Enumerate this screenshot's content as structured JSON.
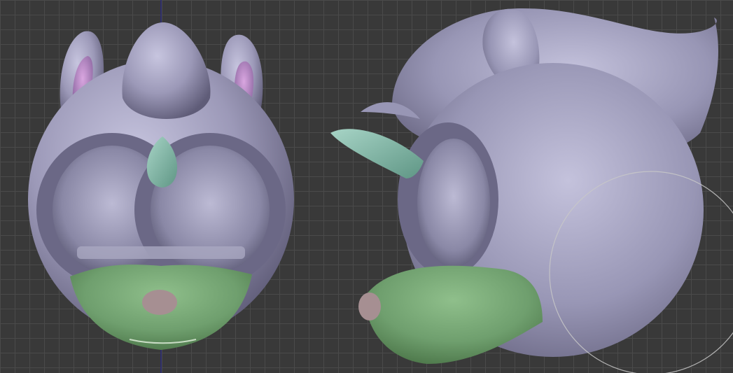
{
  "scene": {
    "colors": {
      "background": "#393939",
      "grid": "#4a4a4a",
      "axis": "#2a2a7a",
      "head": "#9c99b8",
      "head_shadow": "#5f5c78",
      "head_highlight": "#cfcde6",
      "ear_inner": "#b58cc6",
      "muzzle": "#6f9f6e",
      "muzzle_shadow": "#4b7548",
      "horn": "#79b2a4",
      "nose": "#a68f92",
      "brush": "#c8c8c8"
    },
    "icons": [
      "sculpt-brush-circle-icon"
    ]
  }
}
